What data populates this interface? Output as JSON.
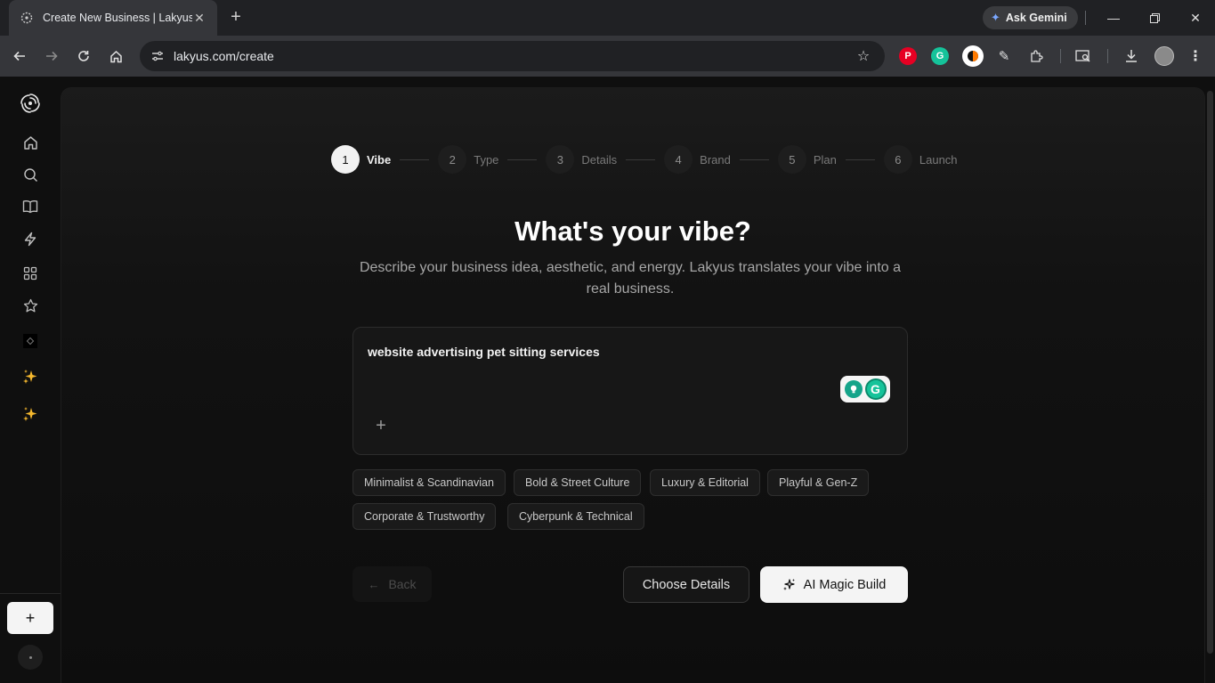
{
  "browser": {
    "tab_title": "Create New Business | Lakyus",
    "url": "lakyus.com/create",
    "gemini_label": "Ask Gemini"
  },
  "stepper": [
    {
      "num": "1",
      "label": "Vibe",
      "active": true
    },
    {
      "num": "2",
      "label": "Type",
      "active": false
    },
    {
      "num": "3",
      "label": "Details",
      "active": false
    },
    {
      "num": "4",
      "label": "Brand",
      "active": false
    },
    {
      "num": "5",
      "label": "Plan",
      "active": false
    },
    {
      "num": "6",
      "label": "Launch",
      "active": false
    }
  ],
  "main": {
    "heading": "What's your vibe?",
    "subtitle": "Describe your business idea, aesthetic, and energy. Lakyus translates your vibe into a real business.",
    "prompt_text": "website advertising pet sitting services"
  },
  "chips": [
    "Minimalist & Scandinavian",
    "Bold & Street Culture",
    "Luxury & Editorial",
    "Playful & Gen-Z",
    "Corporate & Trustworthy",
    "Cyberpunk & Technical"
  ],
  "buttons": {
    "back": "Back",
    "choose_details": "Choose Details",
    "ai_magic_build": "AI Magic Build"
  },
  "colors": {
    "background": "#0f0f0f",
    "accent_light": "#f4f4f4",
    "grammarly_green": "#15c39a"
  }
}
